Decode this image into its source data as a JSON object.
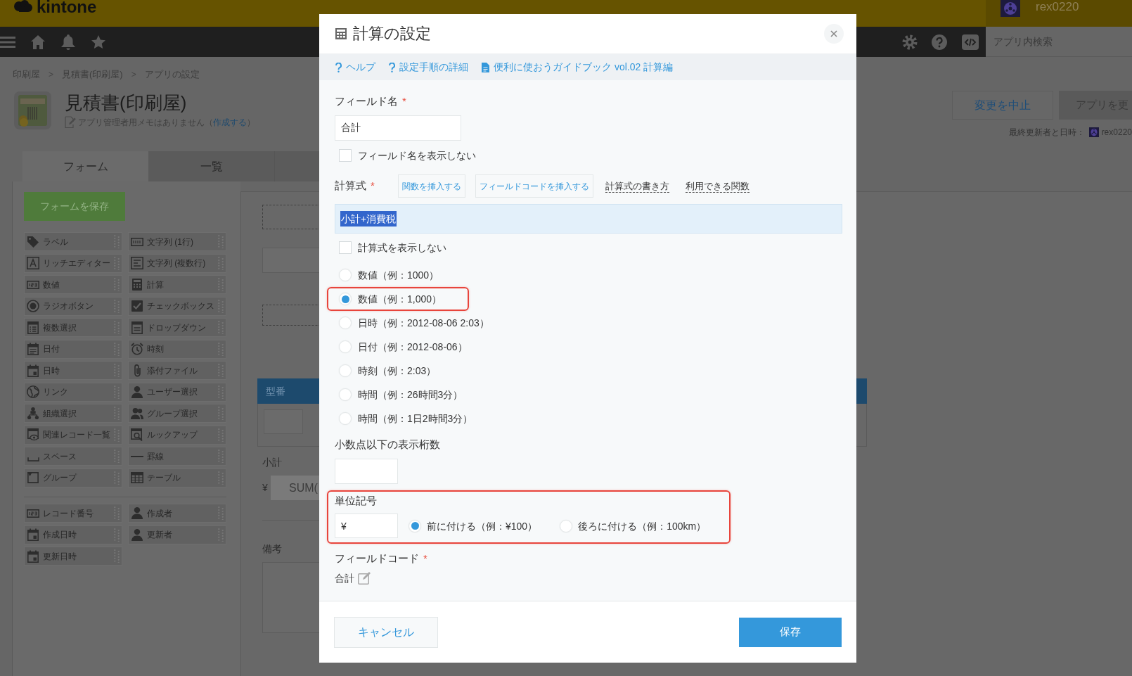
{
  "header": {
    "logo": "kintone",
    "user": "rex0220"
  },
  "nav": {
    "search": {
      "placeholder": "アプリ内検索"
    }
  },
  "breadcrumb": [
    {
      "kind": "crumb",
      "text": "印刷屋"
    },
    {
      "kind": "separator",
      "text": ">"
    },
    {
      "kind": "crumb",
      "text": "見積書(印刷屋)"
    },
    {
      "kind": "separator",
      "text": ">"
    },
    {
      "kind": "crumb",
      "text": "アプリの設定"
    }
  ],
  "app": {
    "title": "見積書(印刷屋)",
    "memo": {
      "before": "アプリ管理者用メモはありません（",
      "link": "作成する",
      "after": "）"
    }
  },
  "actions": [
    {
      "kind": "secondary",
      "label": "変更を中止"
    },
    {
      "kind": "primary",
      "label": "アプリを更"
    }
  ],
  "last_updated": {
    "label": "最終更新者と日時：",
    "user": "rex0220"
  },
  "tabs": [
    {
      "label": "フォーム",
      "selected": true
    },
    {
      "label": "一覧",
      "selected": false
    }
  ],
  "palette": {
    "save_button": "フォームを保存",
    "groups": [
      [
        {
          "kind": "label",
          "label": "ラベル"
        },
        {
          "kind": "text",
          "label": "文字列 (1行)"
        },
        {
          "kind": "rich",
          "label": "リッチエディター"
        },
        {
          "kind": "textarea",
          "label": "文字列 (複数行)"
        },
        {
          "kind": "number",
          "label": "数値"
        },
        {
          "kind": "calc",
          "label": "計算"
        },
        {
          "kind": "radio",
          "label": "ラジオボタン"
        },
        {
          "kind": "check",
          "label": "チェックボックス"
        },
        {
          "kind": "multi",
          "label": "複数選択"
        },
        {
          "kind": "dropdown",
          "label": "ドロップダウン"
        },
        {
          "kind": "date",
          "label": "日付"
        },
        {
          "kind": "time",
          "label": "時刻"
        },
        {
          "kind": "datetime",
          "label": "日時"
        },
        {
          "kind": "file",
          "label": "添付ファイル"
        },
        {
          "kind": "link",
          "label": "リンク"
        },
        {
          "kind": "user",
          "label": "ユーザー選択"
        },
        {
          "kind": "org",
          "label": "組織選択"
        },
        {
          "kind": "group_select",
          "label": "グループ選択"
        },
        {
          "kind": "related",
          "label": "関連レコード一覧"
        },
        {
          "kind": "lookup",
          "label": "ルックアップ"
        },
        {
          "kind": "space",
          "label": "スペース"
        },
        {
          "kind": "rule",
          "label": "罫線"
        },
        {
          "kind": "group",
          "label": "グループ"
        },
        {
          "kind": "table",
          "label": "テーブル"
        }
      ],
      [
        {
          "kind": "record_number",
          "label": "レコード番号"
        },
        {
          "kind": "creator",
          "label": "作成者"
        },
        {
          "kind": "created_at",
          "label": "作成日時"
        },
        {
          "kind": "modifier",
          "label": "更新者"
        },
        {
          "kind": "updated_at",
          "label": "更新日時"
        }
      ]
    ]
  },
  "canvas": {
    "table": {
      "column_1": "型番"
    },
    "fields": [
      {
        "kind": "calc",
        "label": "小計",
        "prefix": "¥",
        "value": "SUM("
      },
      {
        "kind": "textarea",
        "label": "備考"
      }
    ]
  },
  "dialog": {
    "title": "計算の設定",
    "links": [
      {
        "kind": "help",
        "label": "ヘルプ"
      },
      {
        "kind": "help",
        "label": "設定手順の詳細"
      },
      {
        "kind": "document",
        "label": "便利に使おうガイドブック vol.02 計算編"
      }
    ],
    "field_name": {
      "label": "フィールド名",
      "required_mark": "*",
      "value": "合計",
      "hide": {
        "label": "フィールド名を表示しない",
        "checked": false
      }
    },
    "formula": {
      "label": "計算式",
      "required_mark": "*",
      "buttons": [
        "関数を挿入する",
        "フィールドコードを挿入する"
      ],
      "links": [
        "計算式の書き方",
        "利用できる関数"
      ],
      "value": "小計+消費税",
      "text_selected": true,
      "hide": {
        "label": "計算式を表示しない",
        "checked": false
      }
    },
    "format": {
      "options": [
        {
          "label": "数値（例：1000）",
          "selected": false,
          "highlighted": false
        },
        {
          "label": "数値（例：1,000）",
          "selected": true,
          "highlighted": true
        },
        {
          "label": "日時（例：2012-08-06 2:03）",
          "selected": false,
          "highlighted": false
        },
        {
          "label": "日付（例：2012-08-06）",
          "selected": false,
          "highlighted": false
        },
        {
          "label": "時刻（例：2:03）",
          "selected": false,
          "highlighted": false
        },
        {
          "label": "時間（例：26時間3分）",
          "selected": false,
          "highlighted": false
        },
        {
          "label": "時間（例：1日2時間3分）",
          "selected": false,
          "highlighted": false
        }
      ]
    },
    "decimal_places": {
      "label": "小数点以下の表示桁数"
    },
    "unit": {
      "label": "単位記号",
      "value": "¥",
      "highlighted": true,
      "positions": [
        {
          "label": "前に付ける（例：¥100）",
          "selected": true
        },
        {
          "label": "後ろに付ける（例：100km）",
          "selected": false
        }
      ]
    },
    "field_code": {
      "label": "フィールドコード",
      "required_mark": "*",
      "value": "合計"
    },
    "buttons": [
      {
        "kind": "cancel",
        "label": "キャンセル"
      },
      {
        "kind": "save",
        "label": "保存"
      }
    ]
  }
}
